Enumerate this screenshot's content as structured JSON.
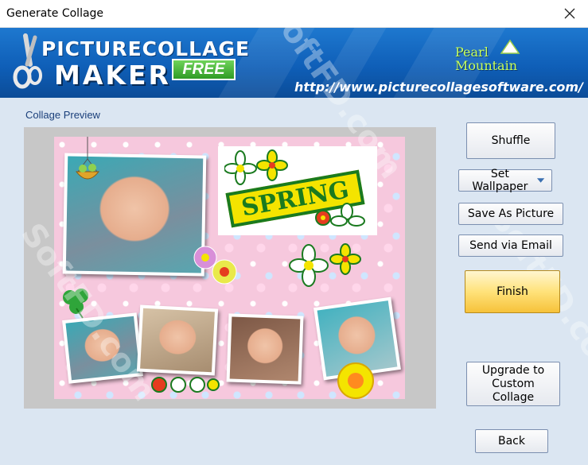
{
  "window": {
    "title": "Generate Collage"
  },
  "banner": {
    "logo_line1": "PICTURECOLLAGE",
    "logo_line2": "MAKER",
    "logo_badge": "FREE",
    "brand": "Pearl Mountain",
    "url": "http://www.picturecollagesoftware.com/"
  },
  "preview": {
    "label": "Collage Preview",
    "spring_text": "SPRING"
  },
  "buttons": {
    "shuffle": "Shuffle",
    "set_wallpaper": "Set Wallpaper",
    "save_as_picture": "Save As Picture",
    "send_via_email": "Send via Email",
    "finish": "Finish",
    "upgrade": "Upgrade to Custom Collage",
    "back": "Back"
  },
  "watermark": "SoftFD.com",
  "colors": {
    "banner": "#0f5fb8",
    "finish_button": "#ffe27a",
    "spring_green": "#1a7a1f",
    "spring_yellow": "#f4e400"
  }
}
